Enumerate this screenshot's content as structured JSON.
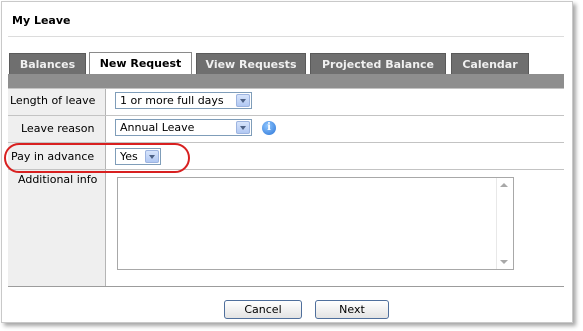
{
  "window": {
    "title": "My Leave"
  },
  "tabs": [
    {
      "label": "Balances",
      "active": false
    },
    {
      "label": "New Request",
      "active": true
    },
    {
      "label": "View Requests",
      "active": false
    },
    {
      "label": "Projected Balance",
      "active": false
    },
    {
      "label": "Calendar",
      "active": false
    }
  ],
  "form": {
    "length_of_leave": {
      "label": "Length of leave",
      "value": "1 or more full days"
    },
    "leave_reason": {
      "label": "Leave reason",
      "value": "Annual Leave"
    },
    "pay_in_advance": {
      "label": "Pay in advance",
      "value": "Yes"
    },
    "additional_info": {
      "label": "Additional info",
      "value": ""
    }
  },
  "info_icon": "i",
  "buttons": {
    "cancel": "Cancel",
    "next": "Next"
  },
  "colors": {
    "tab_inactive": "#6f6f6f",
    "tab_strip": "#8e8e8e",
    "highlight": "#d82020"
  }
}
